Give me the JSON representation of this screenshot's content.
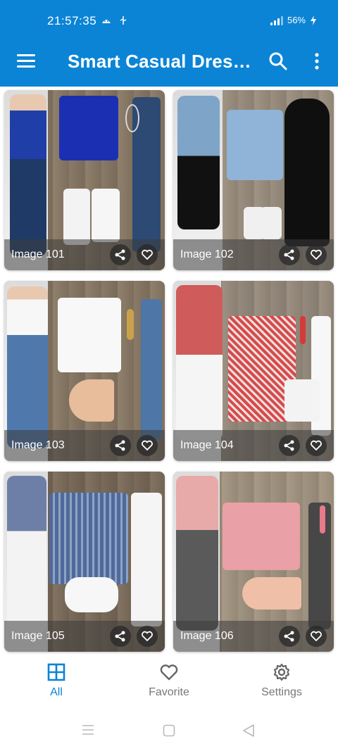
{
  "status": {
    "time": "21:57:35",
    "battery": "56%"
  },
  "appbar": {
    "title": "Smart Casual Dress…"
  },
  "images": [
    {
      "label": "Image 101"
    },
    {
      "label": "Image 102"
    },
    {
      "label": "Image 103"
    },
    {
      "label": "Image 104"
    },
    {
      "label": "Image 105"
    },
    {
      "label": "Image 106"
    }
  ],
  "nav": {
    "items": [
      {
        "label": "All",
        "icon": "grid-icon",
        "active": true
      },
      {
        "label": "Favorite",
        "icon": "heart-icon"
      },
      {
        "label": "Settings",
        "icon": "gear-icon"
      }
    ]
  },
  "colors": {
    "primary": "#0b84d6",
    "inactive": "#777777"
  }
}
